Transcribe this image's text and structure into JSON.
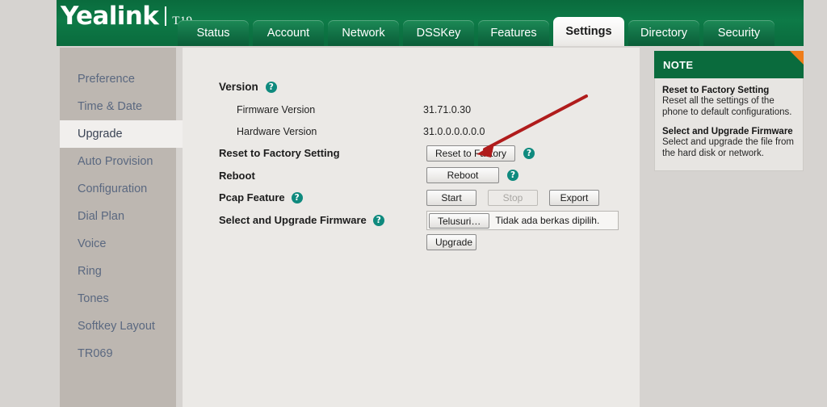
{
  "brand": {
    "name": "Yealink",
    "model": "T19"
  },
  "nav": {
    "tabs": [
      {
        "label": "Status",
        "active": false
      },
      {
        "label": "Account",
        "active": false
      },
      {
        "label": "Network",
        "active": false
      },
      {
        "label": "DSSKey",
        "active": false
      },
      {
        "label": "Features",
        "active": false
      },
      {
        "label": "Settings",
        "active": true
      },
      {
        "label": "Directory",
        "active": false
      },
      {
        "label": "Security",
        "active": false
      }
    ]
  },
  "sidebar": {
    "items": [
      {
        "label": "Preference",
        "active": false
      },
      {
        "label": "Time & Date",
        "active": false
      },
      {
        "label": "Upgrade",
        "active": true
      },
      {
        "label": "Auto Provision",
        "active": false
      },
      {
        "label": "Configuration",
        "active": false
      },
      {
        "label": "Dial Plan",
        "active": false
      },
      {
        "label": "Voice",
        "active": false
      },
      {
        "label": "Ring",
        "active": false
      },
      {
        "label": "Tones",
        "active": false
      },
      {
        "label": "Softkey Layout",
        "active": false
      },
      {
        "label": "TR069",
        "active": false
      }
    ]
  },
  "main": {
    "version_section": {
      "title": "Version",
      "help": "?",
      "firmware_label": "Firmware Version",
      "firmware_value": "31.71.0.30",
      "hardware_label": "Hardware Version",
      "hardware_value": "31.0.0.0.0.0.0"
    },
    "reset_row": {
      "label": "Reset to Factory Setting",
      "button": "Reset to Factory",
      "help": "?"
    },
    "reboot_row": {
      "label": "Reboot",
      "button": "Reboot",
      "help": "?"
    },
    "pcap_row": {
      "label": "Pcap Feature",
      "help": "?",
      "start_button": "Start",
      "stop_button": "Stop",
      "export_button": "Export"
    },
    "upgrade_row": {
      "label": "Select and Upgrade Firmware",
      "help": "?",
      "browse_button": "Telusuri…",
      "file_status": "Tidak ada berkas dipilih.",
      "upgrade_button": "Upgrade"
    }
  },
  "note": {
    "header": "NOTE",
    "entries": [
      {
        "title": "Reset to Factory Setting",
        "text": "Reset all the settings of the phone to default configurations."
      },
      {
        "title": "Select and Upgrade Firmware",
        "text": "Select and upgrade the file from the hard disk or network."
      }
    ]
  },
  "annotation": {
    "arrow_color": "#b01c1c",
    "points_to": "Reset to Factory"
  },
  "colors": {
    "header_green": "#0a6b3d",
    "accent_orange": "#ef7d1a",
    "help_teal": "#0f8a7e",
    "sidebar_taupe": "#bdb7b1",
    "content_bg": "#ebe9e6"
  }
}
